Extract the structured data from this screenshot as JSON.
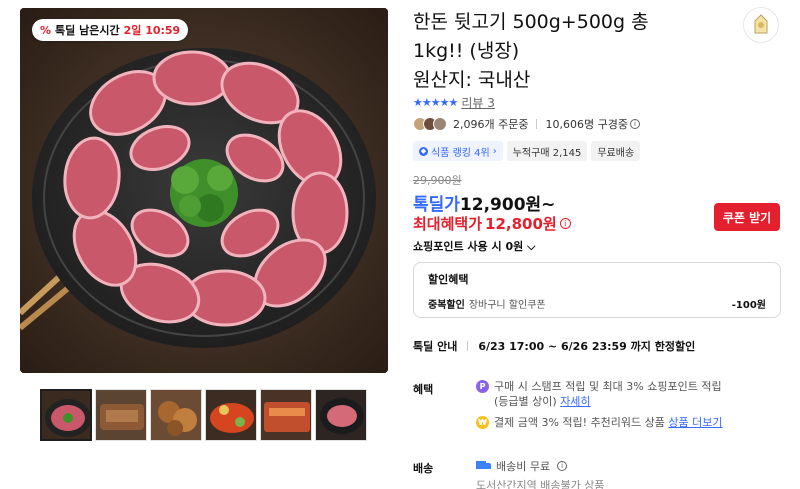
{
  "gallery": {
    "deal_chip": {
      "icon": "percent-icon",
      "text": "톡딜 남은시간",
      "remaining": "2일 10:59"
    },
    "thumbnails": [
      "thumb-1",
      "thumb-2",
      "thumb-3",
      "thumb-4",
      "thumb-5",
      "thumb-6"
    ]
  },
  "product": {
    "title_line1": "한돈 뒷고기 500g+500g 총",
    "title_line2": "1kg!! (냉장)",
    "title_line3": "원산지: 국내산",
    "rating_stars": "★★★★★",
    "review_link": "리뷰 3",
    "orders": "2,096개 주문중",
    "viewers": "10,606명 구경중",
    "rank_badge": "식품 랭킹 4위",
    "cumulative": "누적구매 2,145",
    "free_ship_badge": "무료배송",
    "original_price": "29,900원",
    "deal_label": "톡딜가",
    "deal_price": "12,900원~",
    "max_label": "최대혜택가",
    "max_price": "12,800원",
    "coupon_button": "쿠폰 받기",
    "points": "쇼핑포인트 사용 시 0원"
  },
  "discount_box": {
    "heading": "할인혜택",
    "label": "중복할인",
    "desc": "장바구니 할인쿠폰",
    "amount": "-100원"
  },
  "deal_time": {
    "label": "톡딜 안내",
    "value": "6/23 17:00 ~ 6/26 23:59 까지 한정할인"
  },
  "benefits": {
    "label": "혜택",
    "item1_line1": "구매 시 스탬프 적립 및 최대 3% 쇼핑포인트 적립",
    "item1_line2": "(등급별 상이)",
    "item1_link": "자세히",
    "item2_text": "결제 금액 3% 적립! 추천리워드 상품",
    "item2_link": "상품 더보기"
  },
  "shipping": {
    "label": "배송",
    "fee": "배송비 무료",
    "sub": "도서산간지역 배송불가 상품"
  },
  "colors": {
    "accent_blue": "#346aff",
    "accent_red": "#e5202e"
  }
}
